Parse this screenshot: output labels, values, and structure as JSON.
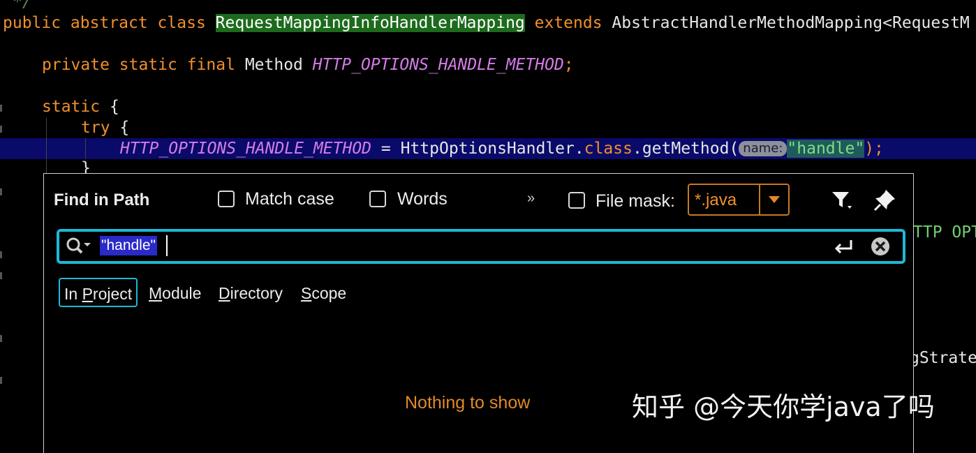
{
  "editor": {
    "comment_end": "*/",
    "class_line": {
      "kw1": "public abstract class",
      "class_name": "RequestMappingInfoHandlerMapping",
      "kw2": "extends",
      "rest": "AbstractHandlerMethodMapping<RequestM"
    },
    "field_line": {
      "kw": "private static final",
      "type": "Method",
      "name": "HTTP_OPTIONS_HANDLE_METHOD",
      "end": ";"
    },
    "static_line": {
      "kw": "static",
      "brace": "{"
    },
    "try_line": {
      "kw": "try",
      "brace": "{"
    },
    "assign_line": {
      "field": "HTTP_OPTIONS_HANDLE_METHOD",
      "op": "=",
      "call1": "HttpOptionsHandler.",
      "kw": "class",
      "call2": ".getMethod(",
      "hint": "name:",
      "arg": "\"handle\"",
      "end": ");"
    },
    "close_brace": "}",
    "right_snippet_1": "TTP OPT",
    "right_snippet_2": "gStrate"
  },
  "dialog": {
    "title": "Find in Path",
    "match_case": {
      "label": "Match case",
      "checked": false
    },
    "words": {
      "label": "Words",
      "checked": false
    },
    "more": "»",
    "file_mask": {
      "label": "File mask:",
      "value": "*.java",
      "checked": false
    },
    "filter_icon": "filter-icon",
    "pin_icon": "pin-icon",
    "search": {
      "value": "\"handle\""
    },
    "scopes": [
      {
        "pre": "In ",
        "key": "P",
        "post": "roject",
        "active": true
      },
      {
        "pre": "",
        "key": "M",
        "post": "odule",
        "active": false
      },
      {
        "pre": "",
        "key": "D",
        "post": "irectory",
        "active": false
      },
      {
        "pre": "",
        "key": "S",
        "post": "cope",
        "active": false
      }
    ],
    "empty_text": "Nothing to show"
  },
  "watermark": "知乎 @今天你学java了吗",
  "colors": {
    "accent": "#1fb8d6",
    "keyword": "#f0902c",
    "field": "#d47ce6",
    "mask": "#c57a20"
  }
}
